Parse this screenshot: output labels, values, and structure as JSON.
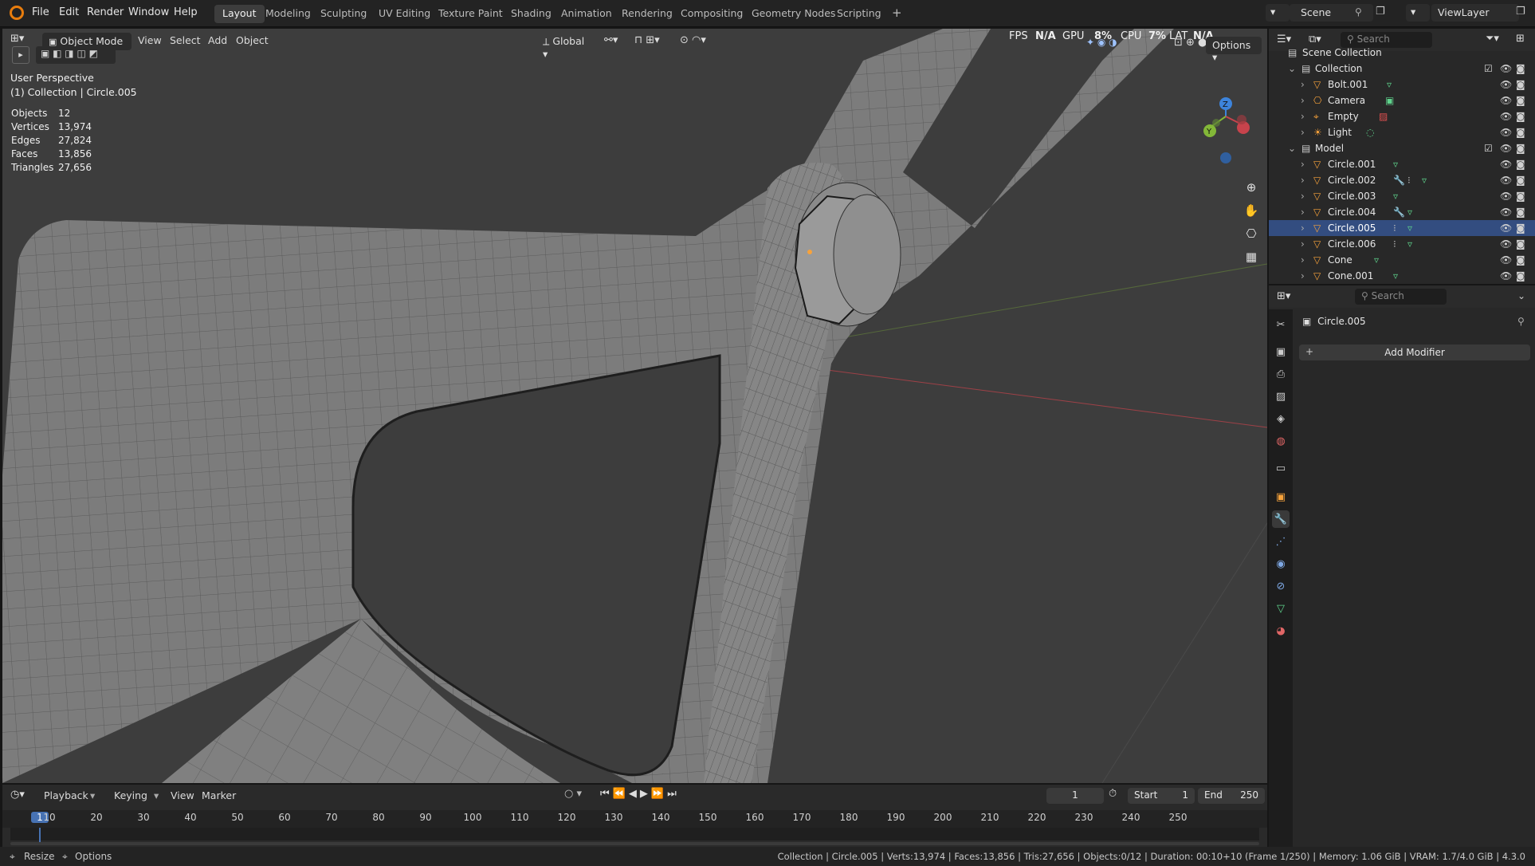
{
  "menu": {
    "items": [
      "File",
      "Edit",
      "Render",
      "Window",
      "Help"
    ]
  },
  "workspaces": [
    "Layout",
    "Modeling",
    "Sculpting",
    "UV Editing",
    "Texture Paint",
    "Shading",
    "Animation",
    "Rendering",
    "Compositing",
    "Geometry Nodes",
    "Scripting"
  ],
  "workspace_add": "+",
  "scene": {
    "label": "Scene",
    "view_layer": "ViewLayer"
  },
  "viewport": {
    "mode": "Object Mode",
    "menus": [
      "View",
      "Select",
      "Add",
      "Object"
    ],
    "transform_orientation": "Global",
    "options_label": "Options",
    "perspective": "User Perspective",
    "context": "(1) Collection | Circle.005",
    "perf": {
      "fps_label": "FPS",
      "fps_value": "N/A",
      "gpu_label": "GPU",
      "gpu_value": "8%",
      "cpu_label": "CPU",
      "cpu_value": "7%",
      "lat_label": "LAT",
      "lat_value": "N/A"
    },
    "stats": [
      {
        "label": "Objects",
        "value": "12"
      },
      {
        "label": "Vertices",
        "value": "13,974"
      },
      {
        "label": "Edges",
        "value": "27,824"
      },
      {
        "label": "Faces",
        "value": "13,856"
      },
      {
        "label": "Triangles",
        "value": "27,656"
      }
    ],
    "gizmo_axes": {
      "z": "Z",
      "y": "Y"
    }
  },
  "outliner": {
    "search_placeholder": "Search",
    "root": "Scene Collection",
    "collections": [
      {
        "name": "Collection",
        "items": [
          "Bolt.001",
          "Camera",
          "Empty",
          "Light"
        ]
      },
      {
        "name": "Model",
        "items": [
          "Circle.001",
          "Circle.002",
          "Circle.003",
          "Circle.004",
          "Circle.005",
          "Circle.006",
          "Cone",
          "Cone.001"
        ]
      }
    ],
    "selected": "Circle.005"
  },
  "properties": {
    "search_placeholder": "Search",
    "object_name": "Circle.005",
    "add_modifier": "Add Modifier"
  },
  "timeline": {
    "menus": [
      "Playback",
      "Keying",
      "View",
      "Marker"
    ],
    "current_frame": "1",
    "start_label": "Start",
    "start_value": "1",
    "end_label": "End",
    "end_value": "250",
    "ruler": [
      "1",
      "10",
      "20",
      "30",
      "40",
      "50",
      "60",
      "70",
      "80",
      "90",
      "100",
      "110",
      "120",
      "130",
      "140",
      "150",
      "160",
      "170",
      "180",
      "190",
      "200",
      "210",
      "220",
      "230",
      "240",
      "250"
    ]
  },
  "status": {
    "left_resize": "Resize",
    "left_options": "Options",
    "right": "Collection | Circle.005 | Verts:13,974 | Faces:13,856 | Tris:27,656 | Objects:0/12 | Duration: 00:10+10 (Frame 1/250) | Memory: 1.06 GiB | VRAM: 1.7/4.0 GiB | 4.3.0"
  },
  "colors": {
    "accent": "#4772b3",
    "selected_orange": "#f7a23b",
    "x_axis": "#c7434c",
    "y_axis": "#83b838",
    "z_axis": "#3d84dc"
  }
}
